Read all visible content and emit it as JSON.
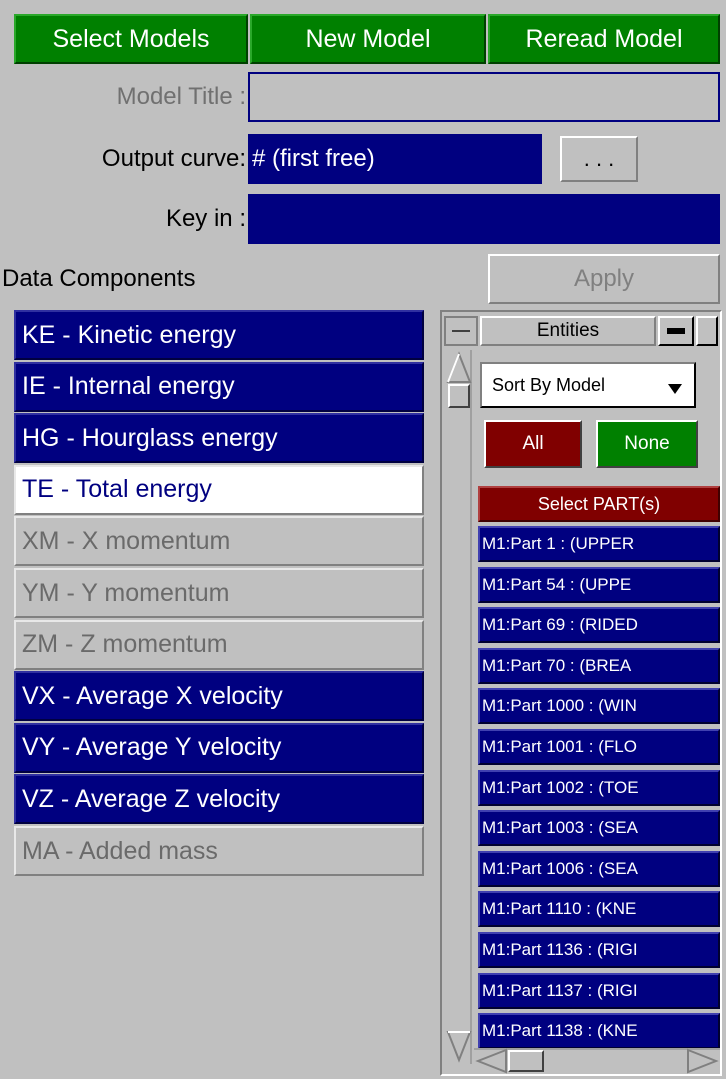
{
  "top_buttons": {
    "select_models": "Select Models",
    "new_model": "New Model",
    "reread_model": "Reread Model"
  },
  "form": {
    "model_title_label": "Model Title :",
    "model_title_value": "",
    "output_curve_label": "Output curve:",
    "output_curve_value": "# (first free)",
    "output_curve_button": ". . .",
    "key_in_label": "Key in :",
    "key_in_value": ""
  },
  "data_components": {
    "heading": "Data Components",
    "apply_label": "Apply",
    "items": [
      {
        "label": "KE  - Kinetic energy",
        "state": "selected"
      },
      {
        "label": "IE  - Internal energy",
        "state": "selected"
      },
      {
        "label": "HG  - Hourglass energy",
        "state": "selected"
      },
      {
        "label": "TE  - Total energy",
        "state": "current"
      },
      {
        "label": "XM  - X momentum",
        "state": "unavailable"
      },
      {
        "label": "YM  - Y momentum",
        "state": "unavailable"
      },
      {
        "label": "ZM  - Z momentum",
        "state": "unavailable"
      },
      {
        "label": "VX  - Average X velocity",
        "state": "selected"
      },
      {
        "label": "VY  - Average Y velocity",
        "state": "selected"
      },
      {
        "label": "VZ  - Average Z velocity",
        "state": "selected"
      },
      {
        "label": "MA  - Added mass",
        "state": "unavailable"
      }
    ]
  },
  "entities": {
    "title": "Entities",
    "sort_label": "Sort By Model",
    "all_label": "All",
    "none_label": "None",
    "select_header": "Select PART(s)",
    "parts": [
      "M1:Part 1 : (UPPER",
      "M1:Part 54 : (UPPE",
      "M1:Part 69 : (RIDED",
      "M1:Part 70 : (BREA",
      "M1:Part 1000 : (WIN",
      "M1:Part 1001 : (FLO",
      "M1:Part 1002 : (TOE",
      "M1:Part 1003 : (SEA",
      "M1:Part 1006 : (SEA",
      "M1:Part 1110 : (KNE",
      "M1:Part 1136 : (RIGI",
      "M1:Part 1137 : (RIGI",
      "M1:Part 1138 : (KNE"
    ]
  },
  "colors": {
    "panel_bg": "#c0c0c0",
    "button_green": "#008000",
    "selected_navy": "#000080",
    "all_red": "#800000",
    "none_green": "#008000"
  }
}
